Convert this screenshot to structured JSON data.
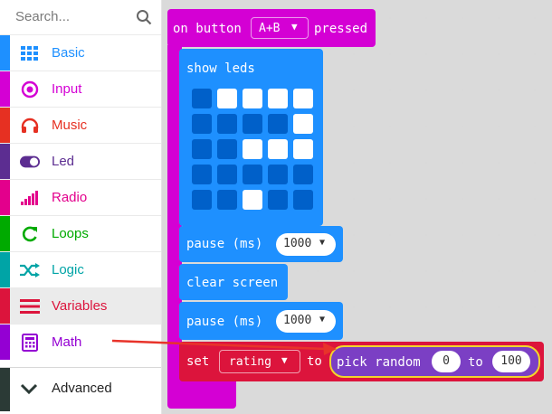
{
  "toolbox": {
    "search_placeholder": "Search...",
    "categories": [
      {
        "label": "Basic",
        "color": "#1e90ff",
        "icon": "grid-icon"
      },
      {
        "label": "Input",
        "color": "#d400d4",
        "icon": "target-icon"
      },
      {
        "label": "Music",
        "color": "#e63022",
        "icon": "headphones-icon"
      },
      {
        "label": "Led",
        "color": "#5c2d91",
        "icon": "toggle-icon"
      },
      {
        "label": "Radio",
        "color": "#e3008c",
        "icon": "signal-bars-icon"
      },
      {
        "label": "Loops",
        "color": "#00aa00",
        "icon": "refresh-icon"
      },
      {
        "label": "Logic",
        "color": "#00a4a6",
        "icon": "shuffle-icon"
      },
      {
        "label": "Variables",
        "color": "#dc143c",
        "icon": "list-icon"
      },
      {
        "label": "Math",
        "color": "#9400d3",
        "icon": "calculator-icon"
      }
    ],
    "advanced_label": "Advanced"
  },
  "workspace": {
    "event_block": {
      "prefix": "on button",
      "button": "A+B",
      "suffix": "pressed"
    },
    "show_leds": {
      "label": "show leds",
      "grid": [
        [
          0,
          1,
          1,
          1,
          1
        ],
        [
          0,
          0,
          0,
          0,
          1
        ],
        [
          0,
          0,
          1,
          1,
          1
        ],
        [
          0,
          0,
          0,
          0,
          0
        ],
        [
          0,
          0,
          1,
          0,
          0
        ]
      ]
    },
    "pause1": {
      "label": "pause (ms)",
      "value": "1000"
    },
    "clear_screen": {
      "label": "clear screen"
    },
    "pause2": {
      "label": "pause (ms)",
      "value": "1000"
    },
    "set_block": {
      "set": "set",
      "variable": "rating",
      "to": "to"
    },
    "pick_random": {
      "label": "pick random",
      "from": "0",
      "to_label": "to",
      "to": "100"
    }
  },
  "colors": {
    "event": "#d400d4",
    "basic": "#1e90ff",
    "variables": "#dc143c",
    "math": "#7b3fc4",
    "highlight": "#f2d62b",
    "arrow": "#e8332a"
  }
}
